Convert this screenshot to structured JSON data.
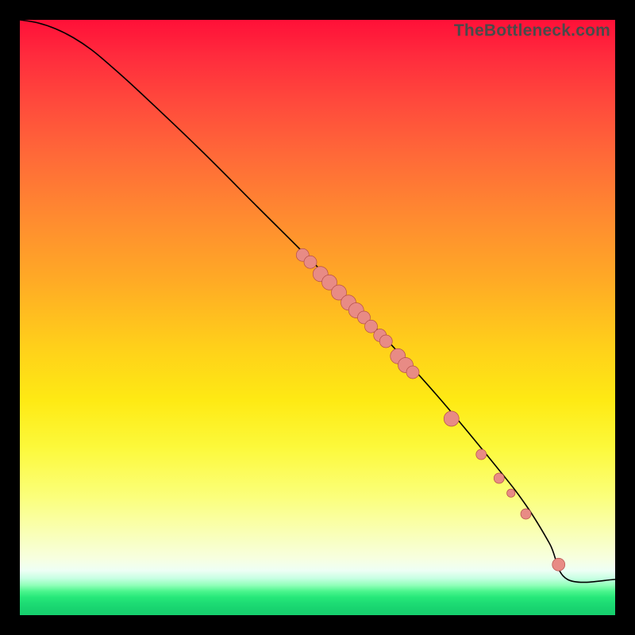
{
  "watermark": "TheBottleneck.com",
  "colors": {
    "point_fill": "#e88b85",
    "point_stroke": "#b54f4a",
    "curve_stroke": "#000000",
    "frame_bg": "#000000"
  },
  "chart_data": {
    "type": "line",
    "title": "",
    "xlabel": "",
    "ylabel": "",
    "xlim": [
      0,
      100
    ],
    "ylim": [
      0,
      100
    ],
    "grid": false,
    "legend": false,
    "series": [
      {
        "name": "curve",
        "kind": "line",
        "x": [
          0,
          3,
          6,
          9,
          12,
          15,
          20,
          30,
          40,
          50,
          60,
          70,
          80,
          85,
          89,
          92,
          100
        ],
        "y": [
          100,
          99.5,
          98.5,
          97,
          95,
          92.5,
          88,
          78.5,
          68.5,
          58.5,
          48,
          37,
          25,
          18.5,
          12,
          6,
          6
        ],
        "note": "Terminal flat segment at y≈6 after x≈92"
      },
      {
        "name": "cluster-points",
        "kind": "scatter",
        "points": [
          {
            "x": 47.5,
            "y": 60.5,
            "size": "md"
          },
          {
            "x": 48.8,
            "y": 59.3,
            "size": "md"
          },
          {
            "x": 50.5,
            "y": 57.3,
            "size": "lg"
          },
          {
            "x": 52.0,
            "y": 55.9,
            "size": "lg"
          },
          {
            "x": 53.6,
            "y": 54.2,
            "size": "lg"
          },
          {
            "x": 55.2,
            "y": 52.5,
            "size": "lg"
          },
          {
            "x": 56.5,
            "y": 51.2,
            "size": "lg"
          },
          {
            "x": 57.8,
            "y": 50.0,
            "size": "md"
          },
          {
            "x": 59.0,
            "y": 48.5,
            "size": "md"
          },
          {
            "x": 60.5,
            "y": 47.0,
            "size": "md"
          },
          {
            "x": 61.5,
            "y": 46.0,
            "size": "md"
          },
          {
            "x": 63.5,
            "y": 43.5,
            "size": "lg"
          },
          {
            "x": 64.8,
            "y": 42.0,
            "size": "lg"
          },
          {
            "x": 66.0,
            "y": 40.8,
            "size": "md"
          },
          {
            "x": 72.5,
            "y": 33.0,
            "size": "lg"
          },
          {
            "x": 77.5,
            "y": 27.0,
            "size": "sm"
          },
          {
            "x": 80.5,
            "y": 23.0,
            "size": "sm"
          },
          {
            "x": 82.5,
            "y": 20.5,
            "size": "xs"
          },
          {
            "x": 85.0,
            "y": 17.0,
            "size": "sm"
          },
          {
            "x": 90.5,
            "y": 8.5,
            "size": "md"
          }
        ]
      }
    ]
  }
}
